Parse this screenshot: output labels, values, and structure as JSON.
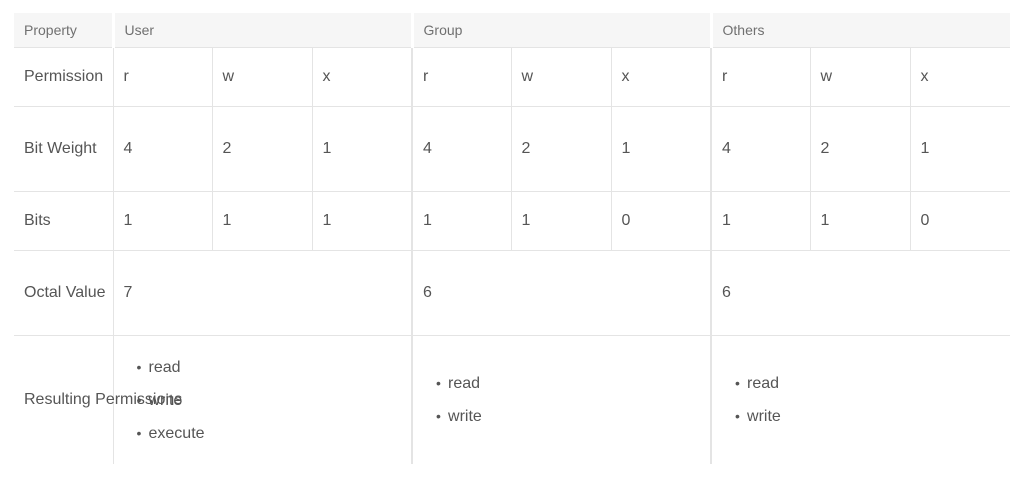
{
  "header": {
    "property": "Property",
    "user": "User",
    "group": "Group",
    "others": "Others"
  },
  "rows": {
    "permission": {
      "label": "Permission",
      "values": [
        "r",
        "w",
        "x",
        "r",
        "w",
        "x",
        "r",
        "w",
        "x"
      ]
    },
    "bit_weight": {
      "label": "Bit Weight",
      "values": [
        "4",
        "2",
        "1",
        "4",
        "2",
        "1",
        "4",
        "2",
        "1"
      ]
    },
    "bits": {
      "label": "Bits",
      "values": [
        "1",
        "1",
        "1",
        "1",
        "1",
        "0",
        "1",
        "1",
        "0"
      ]
    },
    "octal": {
      "label": "Octal Value",
      "values": [
        "7",
        "6",
        "6"
      ]
    },
    "resulting": {
      "label": "Resulting Permissions",
      "user": [
        "read",
        "write",
        "execute"
      ],
      "group": [
        "read",
        "write"
      ],
      "others": [
        "read",
        "write"
      ]
    }
  },
  "bullet_glyph": "•"
}
